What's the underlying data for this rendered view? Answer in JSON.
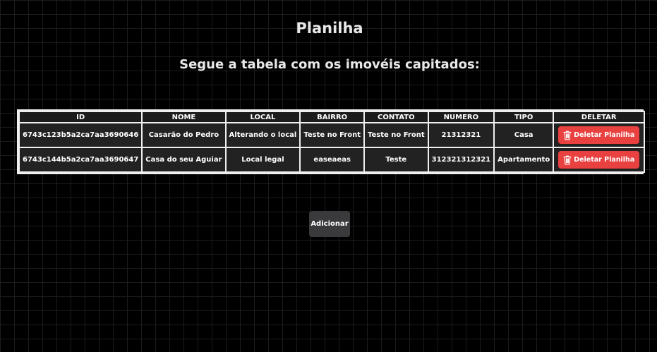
{
  "header": {
    "title": "Planilha",
    "subtitle": "Segue a tabela com os imovéis capitados:"
  },
  "table": {
    "columns": [
      "ID",
      "NOME",
      "LOCAL",
      "BAIRRO",
      "CONTATO",
      "NUMERO",
      "TIPO",
      "DELETAR"
    ],
    "rows": [
      {
        "id": "6743c123b5a2ca7aa3690646",
        "nome": "Casarão do Pedro",
        "local": "Alterando o local",
        "bairro": "Teste no Front",
        "contato": "Teste no Front",
        "numero": "21312321",
        "tipo": "Casa",
        "delete_label": "Deletar Planilha"
      },
      {
        "id": "6743c144b5a2ca7aa3690647",
        "nome": "Casa do seu Aguiar",
        "local": "Local legal",
        "bairro": "easeaeas",
        "contato": "Teste",
        "numero": "312321312321",
        "tipo": "Apartamento",
        "delete_label": "Deletar Planilha"
      }
    ]
  },
  "actions": {
    "add_label": "Adicionar",
    "delete_icon": "trash-icon"
  },
  "colors": {
    "background": "#000000",
    "delete_button": "#e94040",
    "add_button": "#3a3a3c",
    "cell": "#222222",
    "border": "#efefef"
  }
}
